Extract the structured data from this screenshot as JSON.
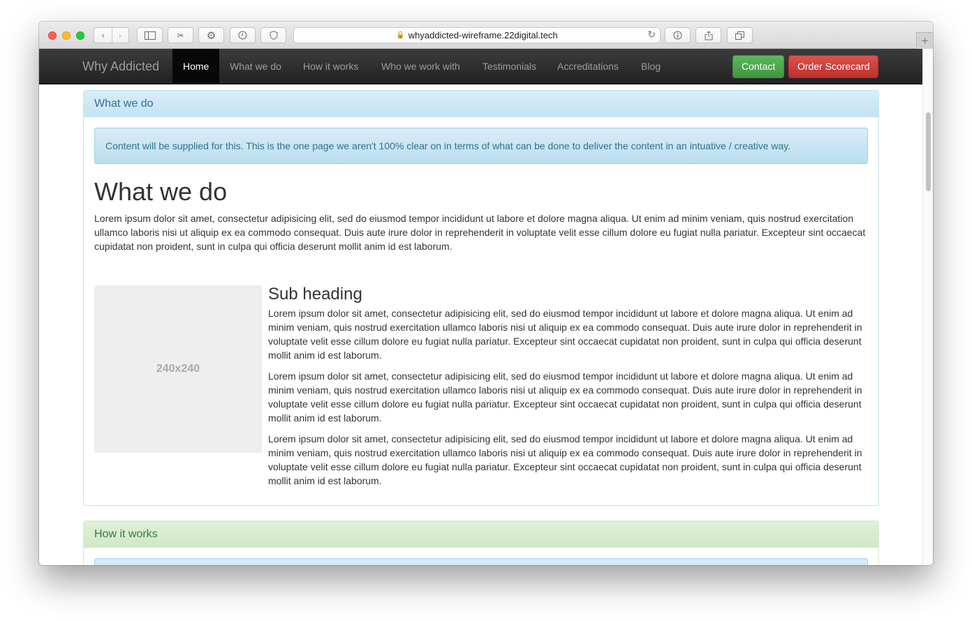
{
  "browser": {
    "url": "whyaddicted-wireframe.22digital.tech"
  },
  "navbar": {
    "brand": "Why Addicted",
    "items": [
      {
        "label": "Home"
      },
      {
        "label": "What we do"
      },
      {
        "label": "How it works"
      },
      {
        "label": "Who we work with"
      },
      {
        "label": "Testimonials"
      },
      {
        "label": "Accreditations"
      },
      {
        "label": "Blog"
      }
    ],
    "contact_label": "Contact",
    "order_label": "Order Scorecard"
  },
  "what_we_do": {
    "panel_title": "What we do",
    "alert": "Content will be supplied for this. This is the one page we aren't 100% clear on in terms of what can be done to deliver the content in an intuative / creative way.",
    "heading": "What we do",
    "intro": "Lorem ipsum dolor sit amet, consectetur adipisicing elit, sed do eiusmod tempor incididunt ut labore et dolore magna aliqua. Ut enim ad minim veniam, quis nostrud exercitation ullamco laboris nisi ut aliquip ex ea commodo consequat. Duis aute irure dolor in reprehenderit in voluptate velit esse cillum dolore eu fugiat nulla pariatur. Excepteur sint occaecat cupidatat non proident, sunt in culpa qui officia deserunt mollit anim id est laborum.",
    "image_placeholder": "240x240",
    "subheading": "Sub heading",
    "paragraphs": [
      "Lorem ipsum dolor sit amet, consectetur adipisicing elit, sed do eiusmod tempor incididunt ut labore et dolore magna aliqua. Ut enim ad minim veniam, quis nostrud exercitation ullamco laboris nisi ut aliquip ex ea commodo consequat. Duis aute irure dolor in reprehenderit in voluptate velit esse cillum dolore eu fugiat nulla pariatur. Excepteur sint occaecat cupidatat non proident, sunt in culpa qui officia deserunt mollit anim id est laborum.",
      "Lorem ipsum dolor sit amet, consectetur adipisicing elit, sed do eiusmod tempor incididunt ut labore et dolore magna aliqua. Ut enim ad minim veniam, quis nostrud exercitation ullamco laboris nisi ut aliquip ex ea commodo consequat. Duis aute irure dolor in reprehenderit in voluptate velit esse cillum dolore eu fugiat nulla pariatur. Excepteur sint occaecat cupidatat non proident, sunt in culpa qui officia deserunt mollit anim id est laborum.",
      "Lorem ipsum dolor sit amet, consectetur adipisicing elit, sed do eiusmod tempor incididunt ut labore et dolore magna aliqua. Ut enim ad minim veniam, quis nostrud exercitation ullamco laboris nisi ut aliquip ex ea commodo consequat. Duis aute irure dolor in reprehenderit in voluptate velit esse cillum dolore eu fugiat nulla pariatur. Excepteur sint occaecat cupidatat non proident, sunt in culpa qui officia deserunt mollit anim id est laborum."
    ]
  },
  "how_it_works": {
    "panel_title": "How it works"
  },
  "colors": {
    "navbar": "#222222",
    "info": "#31708f",
    "success": "#3c763d",
    "contact_button": "#5cb85c",
    "order_button": "#d9534f"
  }
}
